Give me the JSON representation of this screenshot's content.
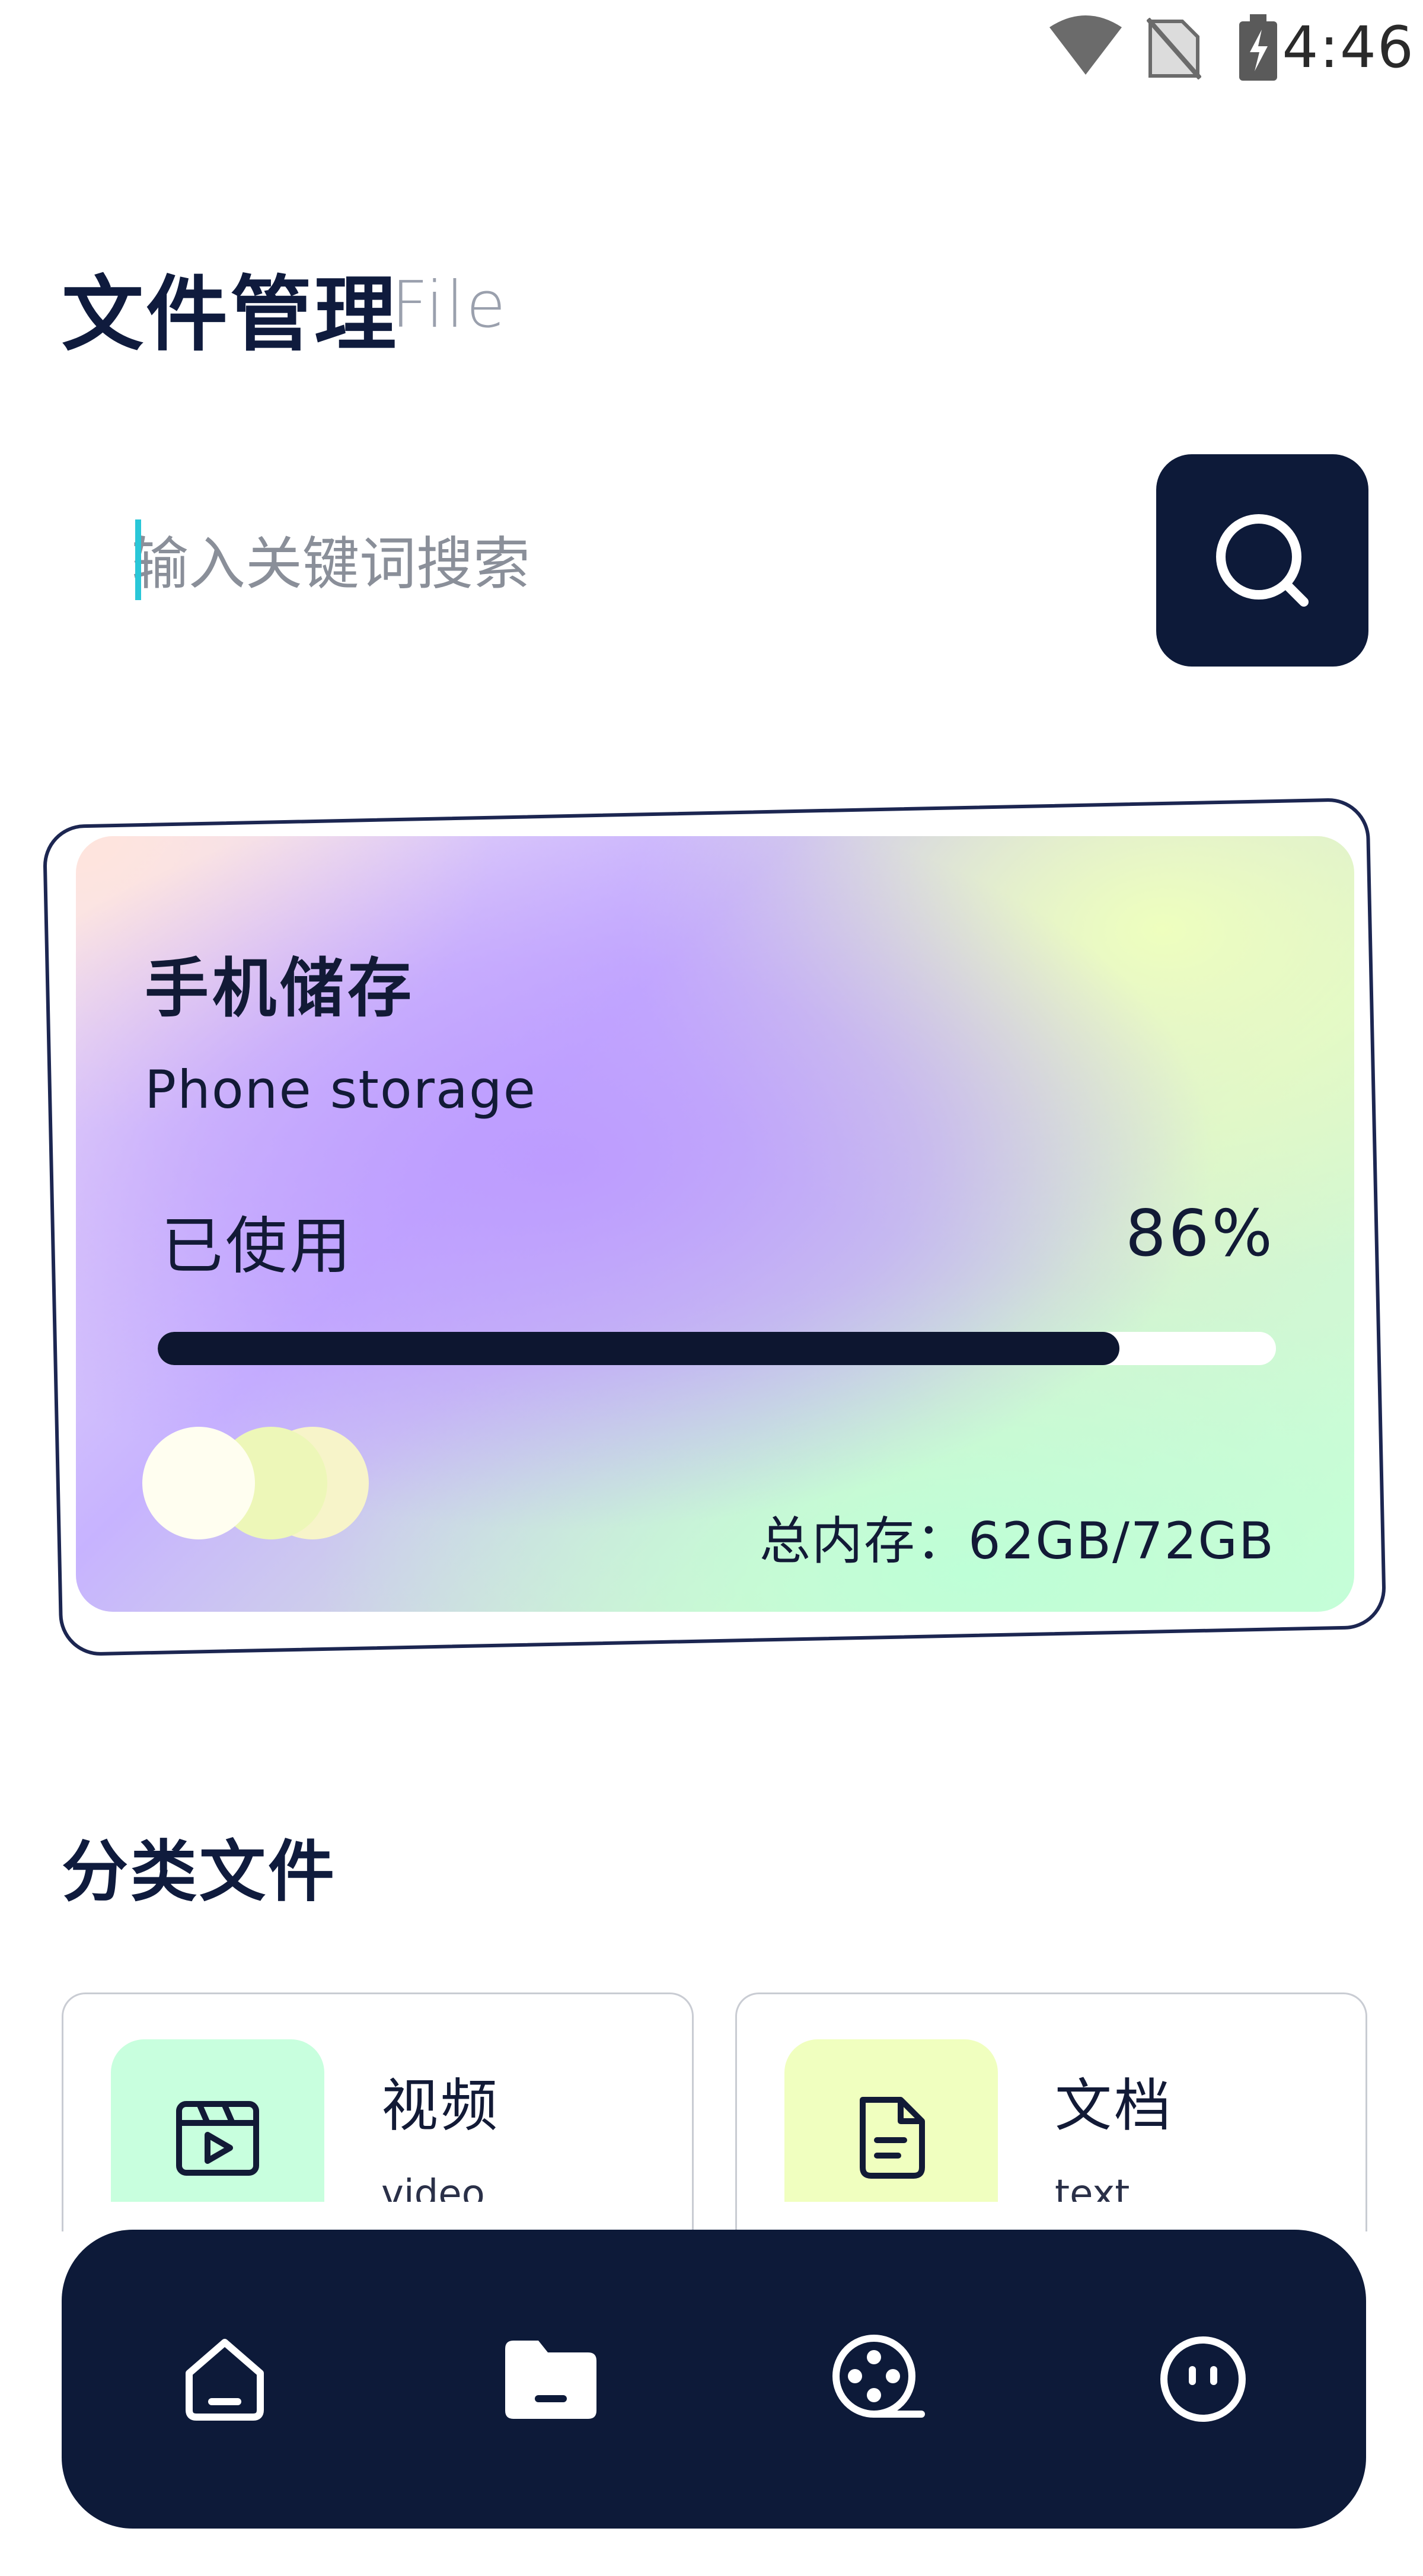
{
  "status_bar": {
    "time": "4:46",
    "icons": [
      "wifi-icon",
      "no-sim-icon",
      "battery-charging-icon"
    ]
  },
  "header": {
    "title": "文件管理",
    "title_en": "File"
  },
  "search": {
    "placeholder": "输入关键词搜索",
    "button_icon": "search-icon"
  },
  "storage": {
    "title": "手机储存",
    "subtitle": "Phone storage",
    "used_label": "已使用",
    "used_percent": "86%",
    "used_fraction": 0.86,
    "total": "总内存：62GB/72GB",
    "colors": {
      "accent_dark": "#0d1630",
      "track": "#ffffff"
    }
  },
  "categories": {
    "title": "分类文件",
    "items": [
      {
        "label": "视频",
        "sub": "video",
        "icon": "video-clapper-icon",
        "color": "#c8ffde"
      },
      {
        "label": "文档",
        "sub": "text",
        "icon": "document-icon",
        "color": "#f0ffbf"
      }
    ]
  },
  "bottom_nav": {
    "items": [
      {
        "icon": "home-icon"
      },
      {
        "icon": "folder-icon"
      },
      {
        "icon": "film-reel-icon"
      },
      {
        "icon": "smiley-icon"
      }
    ],
    "background": "#0d1a39"
  }
}
